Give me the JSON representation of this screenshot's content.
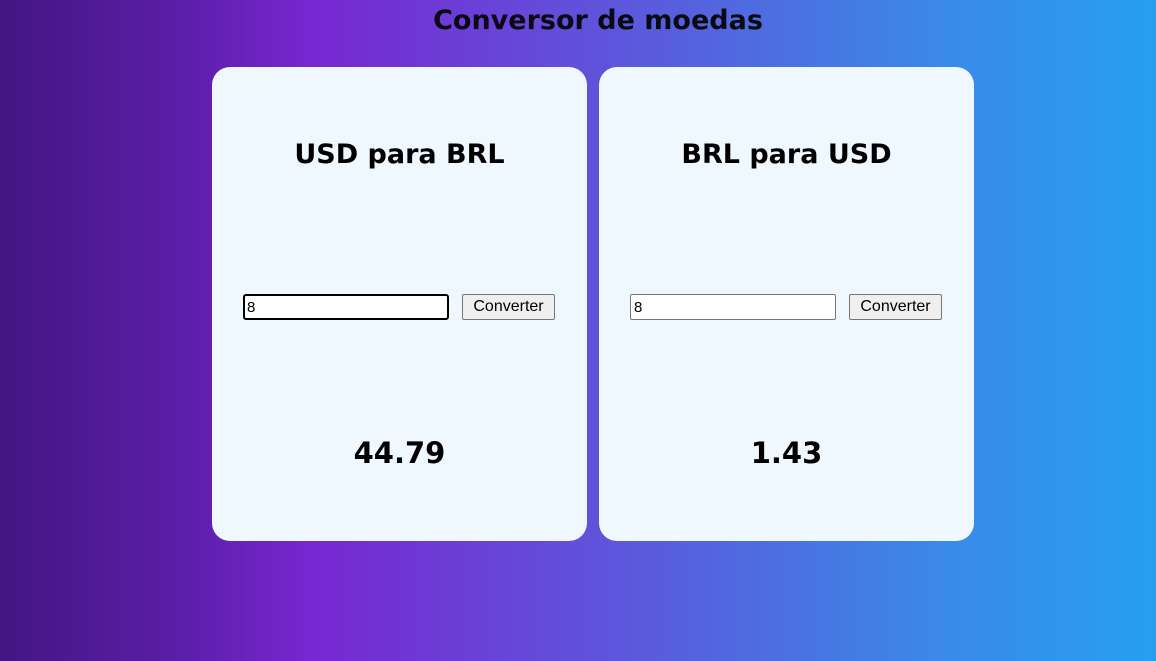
{
  "header": {
    "title": "Conversor de moedas"
  },
  "cards": [
    {
      "title": "USD para BRL",
      "input_value": "8",
      "button_label": "Converter",
      "result": "44.79"
    },
    {
      "title": "BRL para USD",
      "input_value": "8",
      "button_label": "Converter",
      "result": "1.43"
    }
  ],
  "colors": {
    "card_background": "#eff7ff",
    "gradient_start": "#431682",
    "gradient_mid": "#7827d1",
    "gradient_end": "#279ff0"
  }
}
